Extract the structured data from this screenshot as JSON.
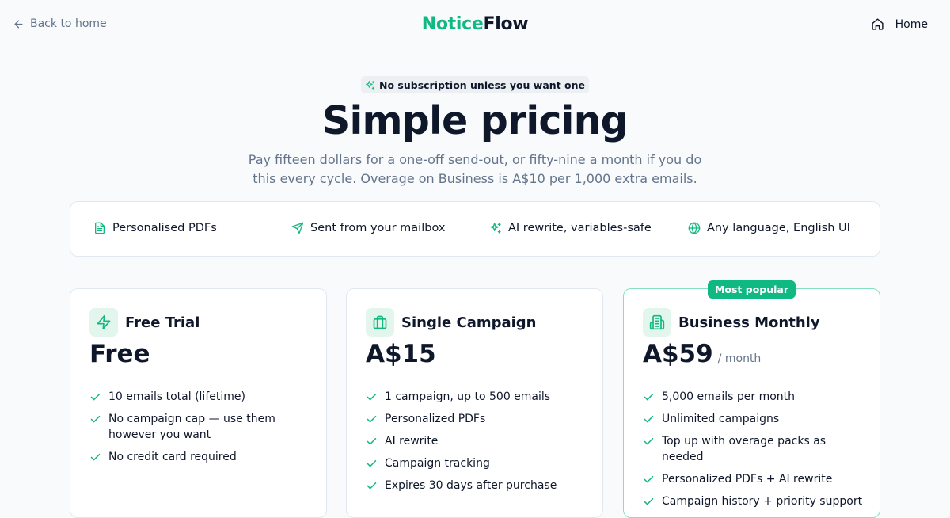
{
  "nav": {
    "back_label": "Back to home",
    "logo_part1": "Notice",
    "logo_part2": "Flow",
    "home_label": "Home"
  },
  "hero": {
    "badge": "No subscription unless you want one",
    "title": "Simple pricing",
    "subtitle": "Pay fifteen dollars for a one-off send-out, or fifty-nine a month if you do this every cycle. Overage on Business is A$10 per 1,000 extra emails."
  },
  "features": [
    {
      "label": "Personalised PDFs",
      "icon": "file-text-icon"
    },
    {
      "label": "Sent from your mailbox",
      "icon": "send-icon"
    },
    {
      "label": "AI rewrite, variables-safe",
      "icon": "sparkles-icon"
    },
    {
      "label": "Any language, English UI",
      "icon": "globe-icon"
    }
  ],
  "plans": [
    {
      "name": "Free Trial",
      "price": "Free",
      "period": "",
      "icon": "zap-icon",
      "items": [
        "10 emails total (lifetime)",
        "No campaign cap — use them however you want",
        "No credit card required"
      ]
    },
    {
      "name": "Single Campaign",
      "price": "A$15",
      "period": "",
      "icon": "briefcase-icon",
      "items": [
        "1 campaign, up to 500 emails",
        "Personalized PDFs",
        "AI rewrite",
        "Campaign tracking",
        "Expires 30 days after purchase"
      ]
    },
    {
      "name": "Business Monthly",
      "price": "A$59",
      "period": "/ month",
      "icon": "building-icon",
      "badge": "Most popular",
      "items": [
        "5,000 emails per month",
        "Unlimited campaigns",
        "Top up with overage packs as needed",
        "Personalized PDFs + AI rewrite",
        "Campaign history + priority support"
      ]
    }
  ],
  "colors": {
    "accent": "#10b981",
    "accent_soft": "#e3f6ee",
    "text": "#0f172a",
    "muted": "#64748b",
    "background": "#f8fafc"
  }
}
